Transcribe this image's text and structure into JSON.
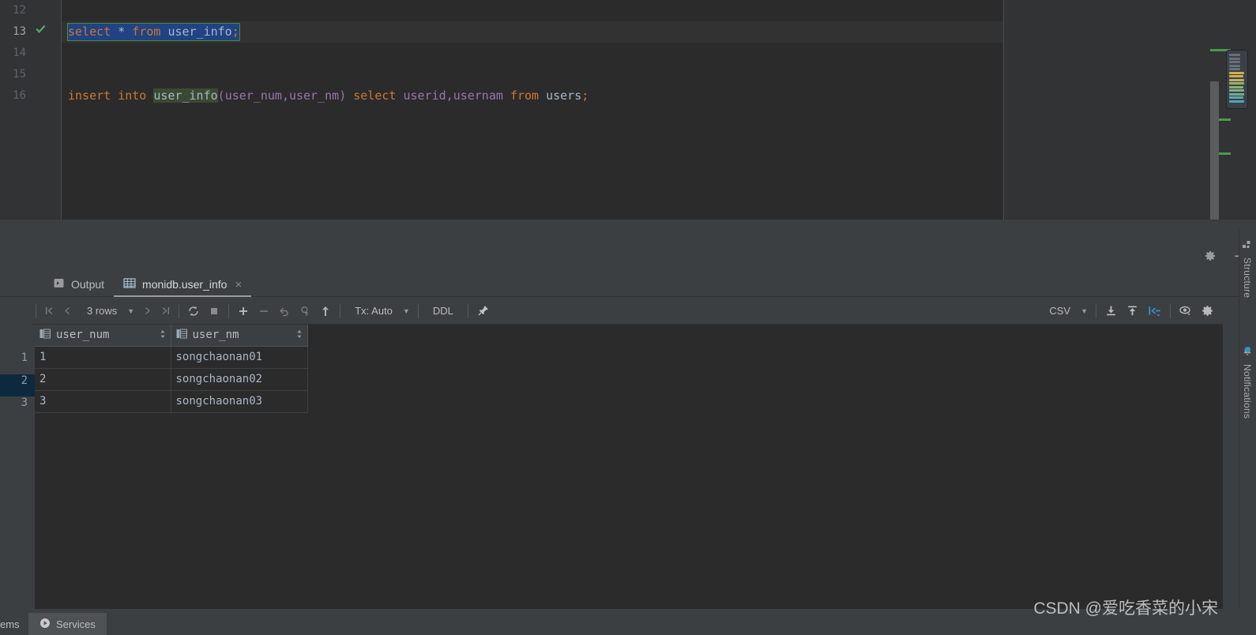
{
  "editor": {
    "lines": [
      {
        "num": "12",
        "checked": false,
        "current": false,
        "tokens": []
      },
      {
        "num": "13",
        "checked": true,
        "current": true,
        "text": "select * from user_info;",
        "tokens": [
          {
            "t": "select",
            "c": "kw"
          },
          {
            "t": " ",
            "c": "op"
          },
          {
            "t": "*",
            "c": "op"
          },
          {
            "t": " ",
            "c": "op"
          },
          {
            "t": "from",
            "c": "kw"
          },
          {
            "t": " ",
            "c": "op"
          },
          {
            "t": "user_info",
            "c": "ident"
          },
          {
            "t": ";",
            "c": "semi"
          }
        ]
      },
      {
        "num": "14",
        "checked": false,
        "current": false,
        "tokens": []
      },
      {
        "num": "15",
        "checked": false,
        "current": false,
        "tokens": []
      },
      {
        "num": "16",
        "checked": false,
        "current": false,
        "text": "insert into user_info(user_num,user_nm) select userid,usernam from users;",
        "tokens": [
          {
            "t": "insert",
            "c": "kw"
          },
          {
            "t": " ",
            "c": "op"
          },
          {
            "t": "into",
            "c": "kw"
          },
          {
            "t": " ",
            "c": "op"
          },
          {
            "t": "user_info",
            "c": "ident tbl-hl"
          },
          {
            "t": "(",
            "c": "col"
          },
          {
            "t": "user_num",
            "c": "col"
          },
          {
            "t": ",",
            "c": "col"
          },
          {
            "t": "user_nm",
            "c": "col"
          },
          {
            "t": ")",
            "c": "col"
          },
          {
            "t": " ",
            "c": "op"
          },
          {
            "t": "select",
            "c": "kw"
          },
          {
            "t": " ",
            "c": "op"
          },
          {
            "t": "userid",
            "c": "col"
          },
          {
            "t": ",",
            "c": "col"
          },
          {
            "t": "usernam",
            "c": "col"
          },
          {
            "t": " ",
            "c": "op"
          },
          {
            "t": "from",
            "c": "kw"
          },
          {
            "t": " ",
            "c": "op"
          },
          {
            "t": "users",
            "c": "ident"
          },
          {
            "t": ";",
            "c": "semi"
          }
        ]
      }
    ],
    "check_icon": "check-mark",
    "stripe_markers": [
      3,
      4,
      5
    ]
  },
  "panel": {
    "settings_icon": "gear-icon",
    "minimize_icon": "minimize-icon",
    "tabs": [
      {
        "label": "Output",
        "icon": "run-output-icon",
        "active": false,
        "closable": false
      },
      {
        "label": "monidb.user_info",
        "icon": "table-icon",
        "active": true,
        "closable": true,
        "close_label": "×"
      }
    ]
  },
  "grid_toolbar": {
    "first_page": "|⟨",
    "prev_page": "⟨",
    "rows_label": "3 rows",
    "next_page": "⟩",
    "last_page": "⟩|",
    "reload": "refresh-icon",
    "stop": "stop-icon",
    "add_row": "+",
    "delete_row": "−",
    "revert": "undo-icon",
    "revert_selected": "revert-selected-icon",
    "submit": "upload-icon",
    "tx_label": "Tx: Auto",
    "ddl_label": "DDL",
    "pin": "pin-icon",
    "format_label": "CSV",
    "download": "download-icon",
    "upload": "upload-to-db-icon",
    "compare": "compare-icon",
    "preview": "eye-icon",
    "settings": "gear-icon"
  },
  "grid": {
    "columns": [
      {
        "name": "user_num",
        "icon": "column-icon",
        "sort": "sort-icon"
      },
      {
        "name": "user_nm",
        "icon": "column-icon",
        "sort": "sort-icon"
      }
    ],
    "rows": [
      {
        "n": "1",
        "user_num": "1",
        "user_nm": "songchaonan01"
      },
      {
        "n": "2",
        "user_num": "2",
        "user_nm": "songchaonan02"
      },
      {
        "n": "3",
        "user_num": "3",
        "user_nm": "songchaonan03"
      }
    ]
  },
  "right_sidebar": {
    "tabs": [
      {
        "label": "Structure",
        "icon": "structure-icon",
        "badge": false
      },
      {
        "label": "Notifications",
        "icon": "bell-icon",
        "badge": true
      }
    ]
  },
  "bottom_bar": {
    "items": [
      {
        "label": "ems",
        "icon": "",
        "active": false
      },
      {
        "label": "Services",
        "icon": "play-icon",
        "active": true
      }
    ]
  },
  "watermark": "CSDN @爱吃香菜的小宋",
  "colors": {
    "editor_bg": "#2b2b2b",
    "panel_bg": "#3c3f41",
    "selection": "#214283",
    "selection_border": "#4a8a3c",
    "keyword": "#cc7832",
    "column": "#9876aa",
    "identifier": "#a9b7c6",
    "accent_blue": "#3592c4",
    "check_green": "#59a869",
    "row_highlight": "#0d293e"
  }
}
